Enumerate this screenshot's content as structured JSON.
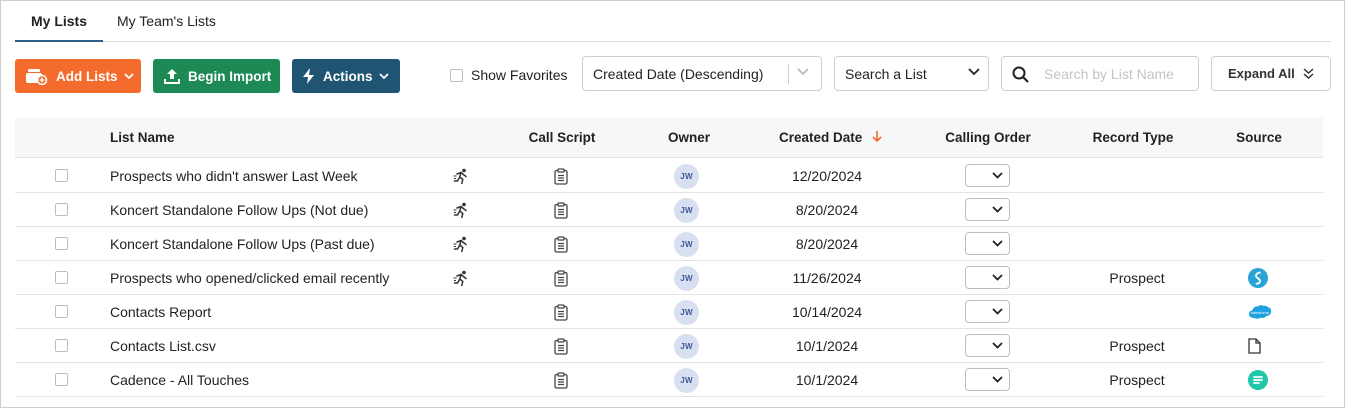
{
  "tabs": [
    {
      "label": "My Lists",
      "active": true
    },
    {
      "label": "My Team's Lists",
      "active": false
    }
  ],
  "toolbar": {
    "add_lists": "Add Lists",
    "begin_import": "Begin Import",
    "actions": "Actions",
    "show_favorites": "Show Favorites",
    "sort_value": "Created Date (Descending)",
    "list_select": "Search a List",
    "search_placeholder": "Search by List Name",
    "expand_all": "Expand All"
  },
  "colors": {
    "add_lists": "#f36c2d",
    "begin_import": "#1d8a56",
    "actions": "#1f5473",
    "sort_arrow": "#f36c2d",
    "active_tab": "#2e5f8a"
  },
  "table": {
    "columns": [
      "List Name",
      "Call Script",
      "Owner",
      "Created Date",
      "Calling Order",
      "Record Type",
      "Source"
    ],
    "rows": [
      {
        "name": "Prospects who didn't answer Last Week",
        "runner": true,
        "owner": "JW",
        "created": "12/20/2024",
        "record_type": "",
        "source": ""
      },
      {
        "name": "Koncert Standalone Follow Ups (Not due)",
        "runner": true,
        "owner": "JW",
        "created": "8/20/2024",
        "record_type": "",
        "source": ""
      },
      {
        "name": "Koncert Standalone Follow Ups (Past due)",
        "runner": true,
        "owner": "JW",
        "created": "8/20/2024",
        "record_type": "",
        "source": ""
      },
      {
        "name": "Prospects who opened/clicked email recently",
        "runner": true,
        "owner": "JW",
        "created": "11/26/2024",
        "record_type": "Prospect",
        "source": "salesloft-icon"
      },
      {
        "name": "Contacts Report",
        "runner": false,
        "owner": "JW",
        "created": "10/14/2024",
        "record_type": "",
        "source": "salesforce-icon"
      },
      {
        "name": "Contacts List.csv",
        "runner": false,
        "owner": "JW",
        "created": "10/1/2024",
        "record_type": "Prospect",
        "source": "file-icon"
      },
      {
        "name": "Cadence - All Touches",
        "runner": false,
        "owner": "JW",
        "created": "10/1/2024",
        "record_type": "Prospect",
        "source": "outreach-icon"
      }
    ]
  }
}
